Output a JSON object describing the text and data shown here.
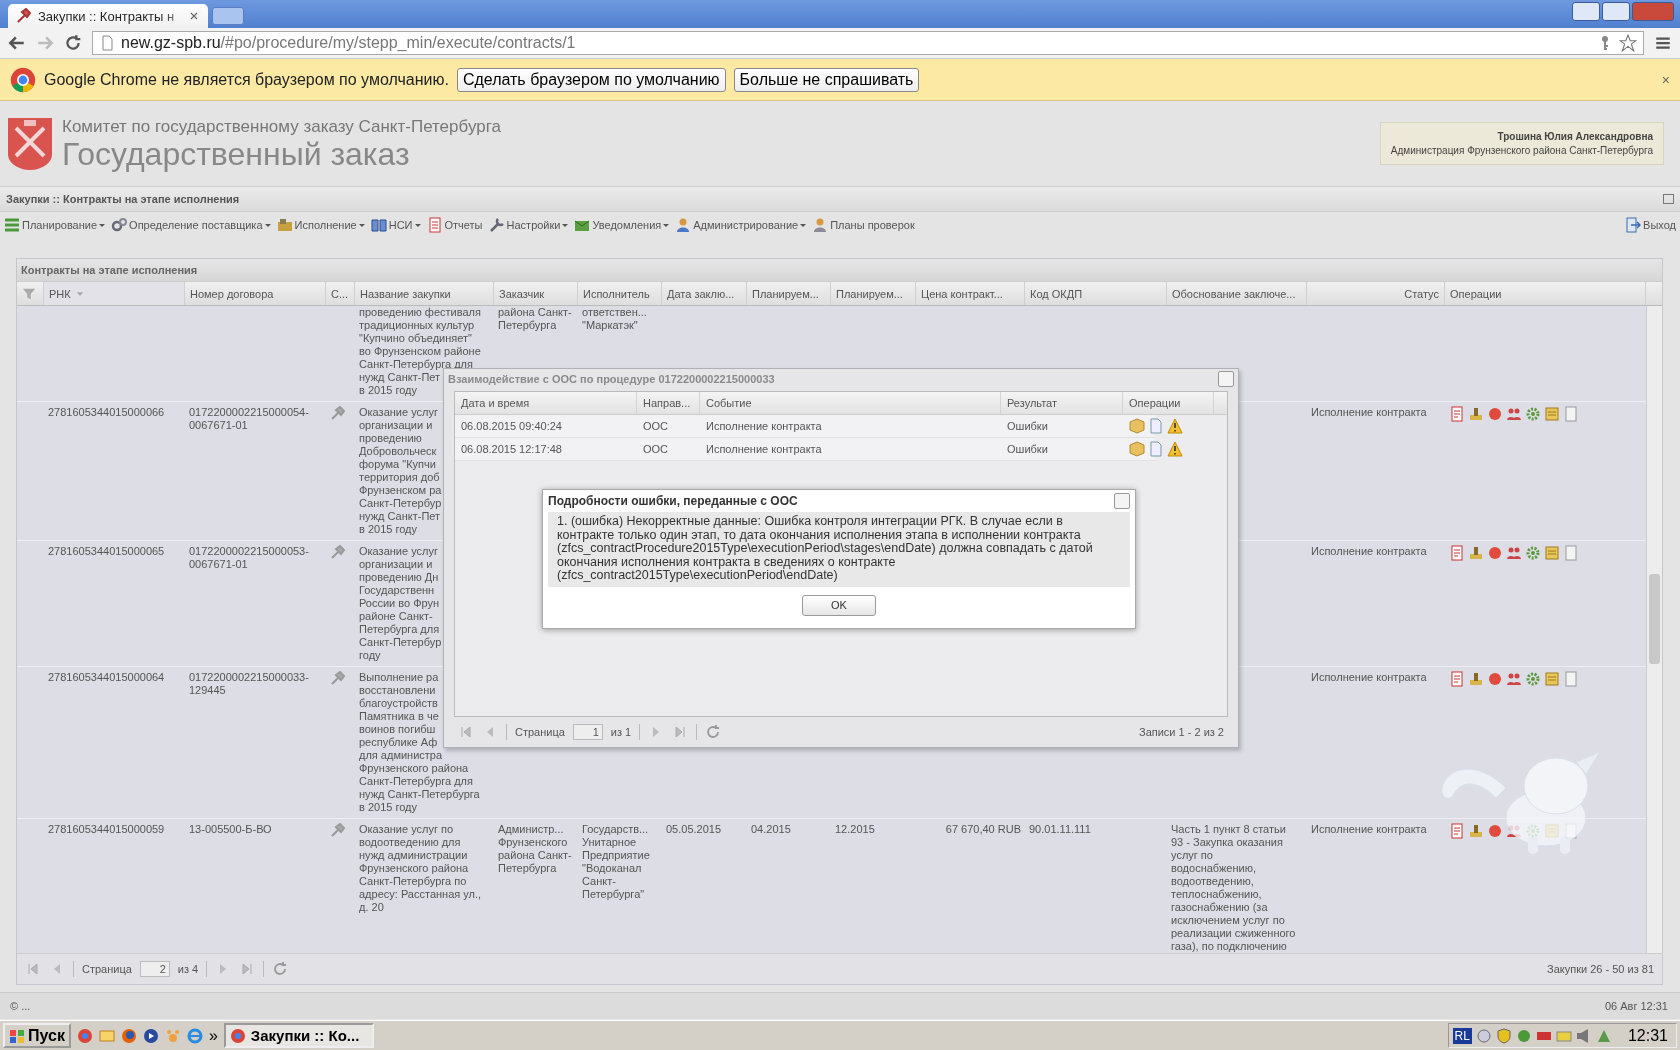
{
  "browser": {
    "tab_title": "Закупки :: Контракты н",
    "url_host": "new.gz-spb.ru",
    "url_path": "/#po/procedure/my/stepp_min/execute/contracts/1"
  },
  "infobar": {
    "message": "Google Chrome не является браузером по умолчанию.",
    "buttons": [
      "Сделать браузером по умолчанию",
      "Больше не спрашивать"
    ],
    "close": "×"
  },
  "header": {
    "org": "Комитет по государственному заказу Санкт-Петербурга",
    "title": "Государственный заказ",
    "user_name": "Трошина Юлия Александровна",
    "user_org": "Администрация Фрунзенского района Санкт-Петербурга"
  },
  "panel": {
    "title": "Закупки :: Контракты на этапе исполнения"
  },
  "toolbar": {
    "items": [
      {
        "label": "Планирование",
        "menu": true
      },
      {
        "label": "Определение поставщика",
        "menu": true
      },
      {
        "label": "Исполнение",
        "menu": true
      },
      {
        "label": "НСИ",
        "menu": true
      },
      {
        "label": "Отчеты",
        "menu": false
      },
      {
        "label": "Настройки",
        "menu": true
      },
      {
        "label": "Уведомления",
        "menu": true
      },
      {
        "label": "Администрирование",
        "menu": true
      },
      {
        "label": "Планы проверок",
        "menu": false
      }
    ],
    "exit": "Выход"
  },
  "grid": {
    "title": "Контракты на этапе исполнения",
    "columns": [
      {
        "label": "РНК",
        "sorted": true
      },
      {
        "label": "Номер договора",
        "sorted": false
      },
      {
        "label": "С...",
        "sorted": false
      },
      {
        "label": "Название закупки",
        "sorted": false
      },
      {
        "label": "Заказчик",
        "sorted": false
      },
      {
        "label": "Исполнитель",
        "sorted": false
      },
      {
        "label": "Дата заклю...",
        "sorted": false
      },
      {
        "label": "Планируем...",
        "sorted": false
      },
      {
        "label": "Планируем...",
        "sorted": false
      },
      {
        "label": "Цена контракт...",
        "sorted": false
      },
      {
        "label": "Код ОКДП",
        "sorted": false
      },
      {
        "label": "Обоснование заключе...",
        "sorted": false
      },
      {
        "label": "Статус",
        "sorted": false
      },
      {
        "label": "Операции",
        "sorted": false
      }
    ],
    "rows": [
      {
        "kind": "continued",
        "name": "проведению фестиваля\nтрадиционных культур\n\"Купчино объединяет\"\nво Фрунзенском районе\nСанкт-Петербурга для\nнужд Санкт-Пет\nв 2015 году",
        "customer": "района Санкт-\nПетербурга",
        "supplier": "ответствен...\n\"Маркатэк\""
      },
      {
        "kind": "full",
        "rnk": "2781605344015000066",
        "number": "0172200002215000054-\n0067671-01",
        "name": "Оказание услуг\nорганизации и\nпроведению\nДобровольческ\nфорума \"Купчи\nтерритория доб\nФрунзенском ра\nСанкт-Петербур\nнужд Санкт-Пет\nв 2015 году",
        "status": "Исполнение контракта"
      },
      {
        "kind": "full",
        "rnk": "2781605344015000065",
        "number": "0172200002215000053-\n0067671-01",
        "name": "Оказание услуг\nорганизации и\nпроведению Дн\nГосударственн\nРоссии во Фрун\nрайоне Санкт-\nПетербурга для\nСанкт-Петербур\nгоду",
        "status": "Исполнение контракта"
      },
      {
        "kind": "full",
        "rnk": "2781605344015000064",
        "number": "0172200002215000033-\n129445",
        "name": "Выполнение ра\nвосстановлени\nблагоустройств\nПамятника в че\nвоинов погибш\nреспублике Аф\nдля администра\nФрунзенского района\nСанкт-Петербурга для\nнужд Санкт-Петербурга\nв 2015 году",
        "status": "Исполнение контракта"
      },
      {
        "kind": "full",
        "rnk": "2781605344015000059",
        "number": "13-005500-Б-ВО",
        "name": "Оказание услуг по\nводоотведению для\nнужд администрации\nФрунзенского района\nСанкт-Петербурга по\nадресу: Расстанная ул.,\nд. 20",
        "customer": "Администр...\nФрунзенского\nрайона Санкт-\nПетербурга",
        "supplier": "Государств...\nУнитарное\nПредприятие\n\"Водоканал\nСанкт-\nПетербурга\"",
        "date": "05.05.2015",
        "plan_start": "04.2015",
        "plan_end": "12.2015",
        "price": "67 670,40 RUB",
        "okdp": "90.01.11.111",
        "basis": "Часть 1 пункт 8 статьи\n93 - Закупка оказания\nуслуг по\nводоснабжению,\nводоотведению,\nтеплоснабжению,\nгазоснабжению (за\nисключением услуг по\nреализации сжиженного\nгаза), по подключению",
        "status": "Исполнение контракта"
      }
    ],
    "paging": {
      "label": "Страница",
      "page": "2",
      "of": "из 4",
      "records": "Закупки 26 - 50 из 81"
    }
  },
  "exchange_dialog": {
    "title": "Взаимодействие с ООС по процедуре 0172200002215000033",
    "columns": [
      "Дата и время",
      "Направ...",
      "Событие",
      "Результат",
      "Операции"
    ],
    "rows": [
      {
        "time": "06.08.2015 09:40:24",
        "direction": "ООС",
        "event": "Исполнение контракта",
        "result": "Ошибки"
      },
      {
        "time": "06.08.2015 12:17:48",
        "direction": "ООС",
        "event": "Исполнение контракта",
        "result": "Ошибки"
      }
    ],
    "paging": {
      "label": "Страница",
      "page": "1",
      "of": "из 1",
      "records": "Записи 1 - 2 из 2"
    }
  },
  "error_dialog": {
    "title": "Подробности ошибки, переданные с ООС",
    "message": "1. (ошибка) Некорректные данные: Ошибка контроля интеграции РГК. В случае если в контракте только один этап, то дата окончания исполнения этапа в исполнении контракта (zfcs_contractProcedure2015Type\\executionPeriod\\stages\\endDate) должна совпадать с датой окончания исполнения контракта в сведениях о контракте (zfcs_contract2015Type\\executionPeriod\\endDate)",
    "ok": "OK"
  },
  "footer": {
    "copyright": "© ...",
    "datetime": "06 Авг 12:31"
  },
  "taskbar": {
    "start": "Пуск",
    "more": "»",
    "tasks": [
      {
        "label": "Закупки :: Ко...",
        "selected": true
      }
    ],
    "lang": "RL",
    "clock": "12:31"
  }
}
